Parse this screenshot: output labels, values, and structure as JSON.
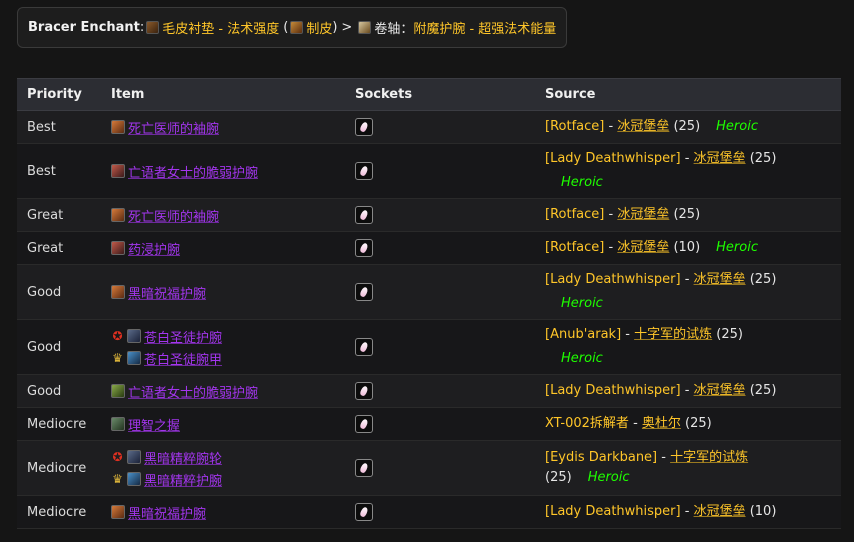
{
  "enchant": {
    "label": "Bracer Enchant",
    "colon": ":",
    "option1": "毛皮衬垫 - 法术强度",
    "paren_open": "(",
    "option1_prof": "制皮",
    "paren_close": ")",
    "separator": ">",
    "option2_prefix": "卷轴：",
    "option2": "附魔护腕 - 超强法术能量"
  },
  "table": {
    "headers": {
      "priority": "Priority",
      "item": "Item",
      "sockets": "Sockets",
      "source": "Source"
    },
    "rows": [
      {
        "priority": "Best",
        "items": [
          {
            "name": "死亡医师的袖腕"
          }
        ],
        "source": {
          "name": "[Rotface]",
          "sep": " - ",
          "zone": "冰冠堡垒",
          "size": " (25)",
          "heroic": "Heroic"
        }
      },
      {
        "priority": "Best",
        "items": [
          {
            "name": "亡语者女士的脆弱护腕"
          }
        ],
        "source": {
          "name": "[Lady Deathwhisper]",
          "sep": " - ",
          "zone": "冰冠堡垒",
          "size": " (25)",
          "heroic": "Heroic"
        }
      },
      {
        "priority": "Great",
        "items": [
          {
            "name": "死亡医师的袖腕"
          }
        ],
        "source": {
          "name": "[Rotface]",
          "sep": " - ",
          "zone": "冰冠堡垒",
          "size": " (25)",
          "heroic": ""
        }
      },
      {
        "priority": "Great",
        "items": [
          {
            "name": "药浸护腕"
          }
        ],
        "source": {
          "name": "[Rotface]",
          "sep": " - ",
          "zone": "冰冠堡垒",
          "size": " (10)",
          "heroic": "Heroic"
        }
      },
      {
        "priority": "Good",
        "items": [
          {
            "name": "黑暗祝福护腕"
          }
        ],
        "source": {
          "name": "[Lady Deathwhisper]",
          "sep": " - ",
          "zone": "冰冠堡垒",
          "size": " (25)",
          "heroic": "Heroic"
        }
      },
      {
        "priority": "Good",
        "items": [
          {
            "name": "苍白圣徒护腕",
            "faction": "horde"
          },
          {
            "name": "苍白圣徒腕甲",
            "faction": "alliance"
          }
        ],
        "source": {
          "name": "[Anub'arak]",
          "sep": " - ",
          "zone": "十字军的试炼",
          "size": " (25)",
          "heroic": "Heroic"
        }
      },
      {
        "priority": "Good",
        "items": [
          {
            "name": "亡语者女士的脆弱护腕"
          }
        ],
        "source": {
          "name": "[Lady Deathwhisper]",
          "sep": " - ",
          "zone": "冰冠堡垒",
          "size": " (25)",
          "heroic": ""
        }
      },
      {
        "priority": "Mediocre",
        "items": [
          {
            "name": "理智之握"
          }
        ],
        "source": {
          "name": "XT-002拆解者",
          "sep": " - ",
          "zone": "奥杜尔",
          "size": " (25)",
          "heroic": ""
        }
      },
      {
        "priority": "Mediocre",
        "items": [
          {
            "name": "黑暗精粹腕轮",
            "faction": "horde"
          },
          {
            "name": "黑暗精粹护腕",
            "faction": "alliance"
          }
        ],
        "source": {
          "name": "[Eydis Darkbane]",
          "sep": " - ",
          "zone": "十字军的试炼",
          "size": "(25)",
          "heroic": "Heroic"
        }
      },
      {
        "priority": "Mediocre",
        "items": [
          {
            "name": "黑暗祝福护腕"
          }
        ],
        "source": {
          "name": "[Lady Deathwhisper]",
          "sep": " - ",
          "zone": "冰冠堡垒",
          "size": " (10)",
          "heroic": ""
        }
      }
    ]
  }
}
